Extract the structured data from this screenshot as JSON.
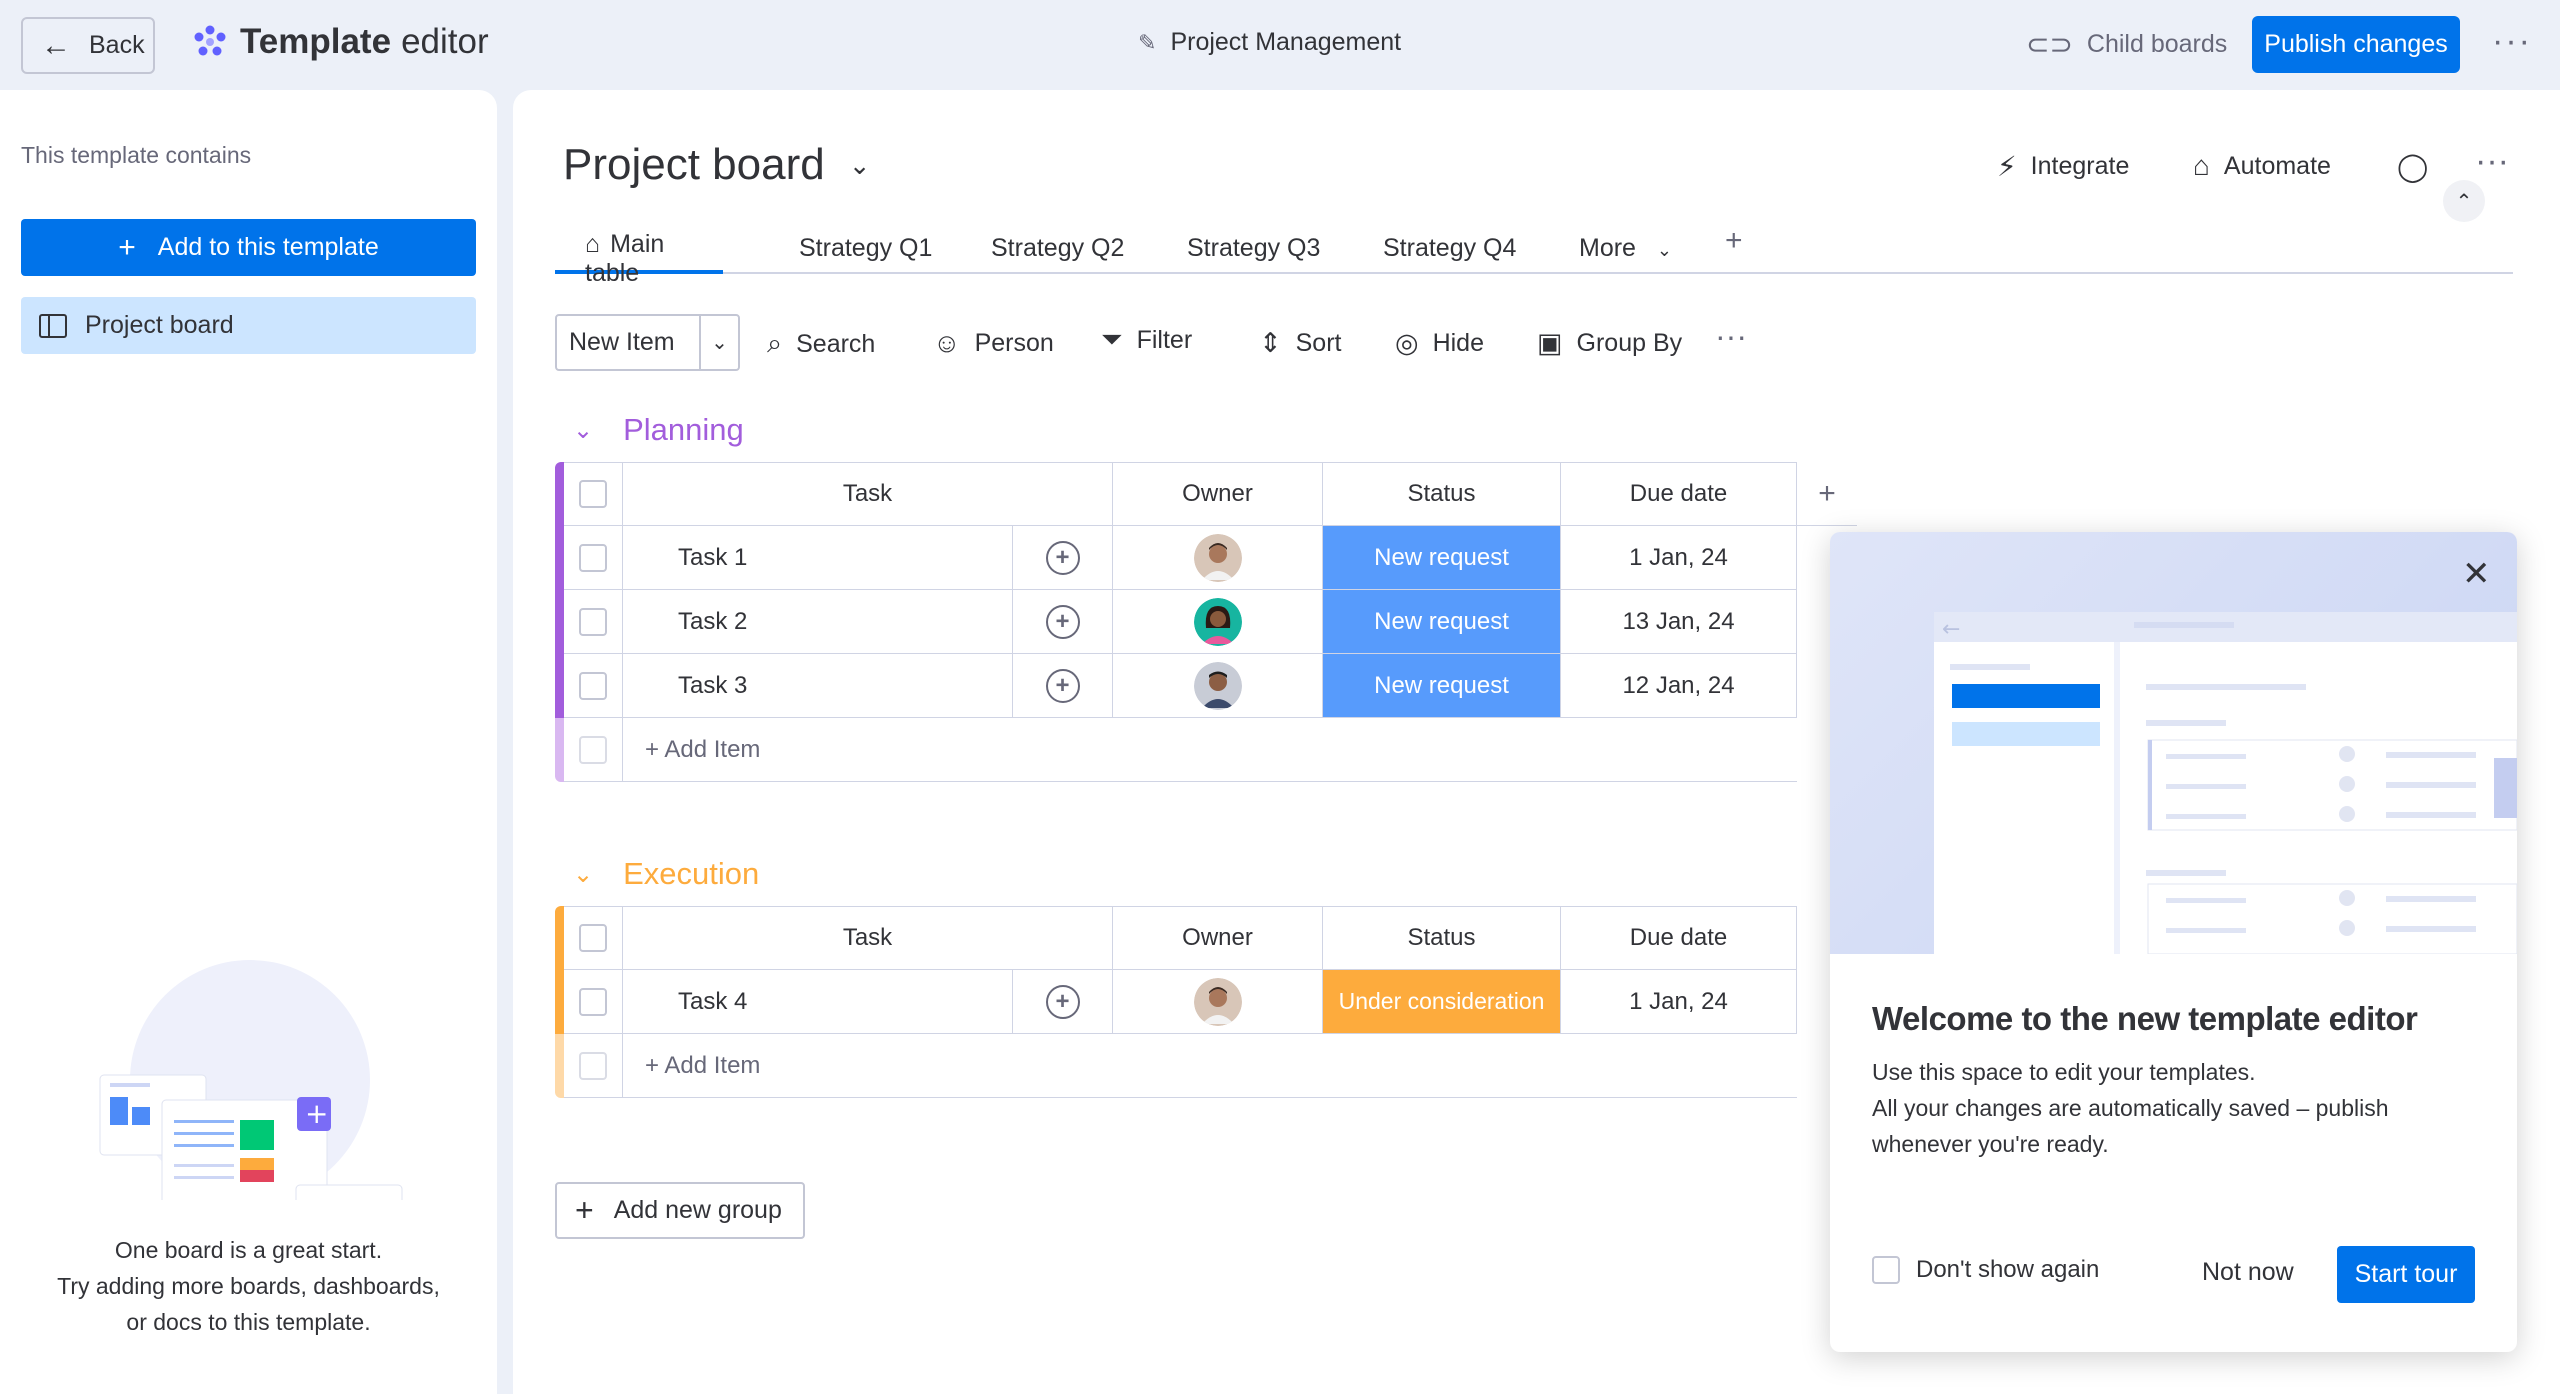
{
  "topbar": {
    "back_label": "Back",
    "brand_bold": "Template",
    "brand_rest": "editor",
    "center_title": "Project Management",
    "child_boards": "Child boards",
    "publish": "Publish changes"
  },
  "sidebar": {
    "title": "This template contains",
    "add_label": "Add to this template",
    "items": [
      {
        "label": "Project board"
      }
    ],
    "footer": [
      "One board is a great start.",
      "Try adding more boards, dashboards,",
      "or docs to this template."
    ]
  },
  "board": {
    "title": "Project board",
    "actions": {
      "integrate": "Integrate",
      "automate": "Automate"
    },
    "tabs": [
      {
        "label": "Main table"
      },
      {
        "label": "Strategy Q1"
      },
      {
        "label": "Strategy Q2"
      },
      {
        "label": "Strategy Q3"
      },
      {
        "label": "Strategy Q4"
      },
      {
        "label": "More"
      }
    ],
    "toolbar": {
      "new_item": "New Item",
      "search": "Search",
      "person": "Person",
      "filter": "Filter",
      "sort": "Sort",
      "hide": "Hide",
      "group_by": "Group By"
    },
    "columns": {
      "task": "Task",
      "owner": "Owner",
      "status": "Status",
      "due": "Due date"
    },
    "add_item": "+ Add Item",
    "add_group": "Add new group",
    "groups": [
      {
        "name": "Planning",
        "color": "#a25ddc",
        "rows": [
          {
            "task": "Task 1",
            "status": "New request",
            "due": "1 Jan, 24"
          },
          {
            "task": "Task 2",
            "status": "New request",
            "due": "13 Jan, 24"
          },
          {
            "task": "Task 3",
            "status": "New request",
            "due": "12 Jan, 24"
          }
        ]
      },
      {
        "name": "Execution",
        "color": "#fdab3d",
        "rows": [
          {
            "task": "Task 4",
            "status": "Under consideration",
            "due": "1 Jan, 24"
          }
        ]
      }
    ]
  },
  "modal": {
    "title": "Welcome to the new template editor",
    "body": [
      "Use this space to edit your templates.",
      "All your changes are automatically saved – publish",
      "whenever you're ready."
    ],
    "dont_show": "Don't show again",
    "not_now": "Not now",
    "start_tour": "Start tour"
  },
  "colors": {
    "accent": "#0073ea",
    "status_blue": "#579bfc",
    "status_orange": "#fdab3d"
  }
}
